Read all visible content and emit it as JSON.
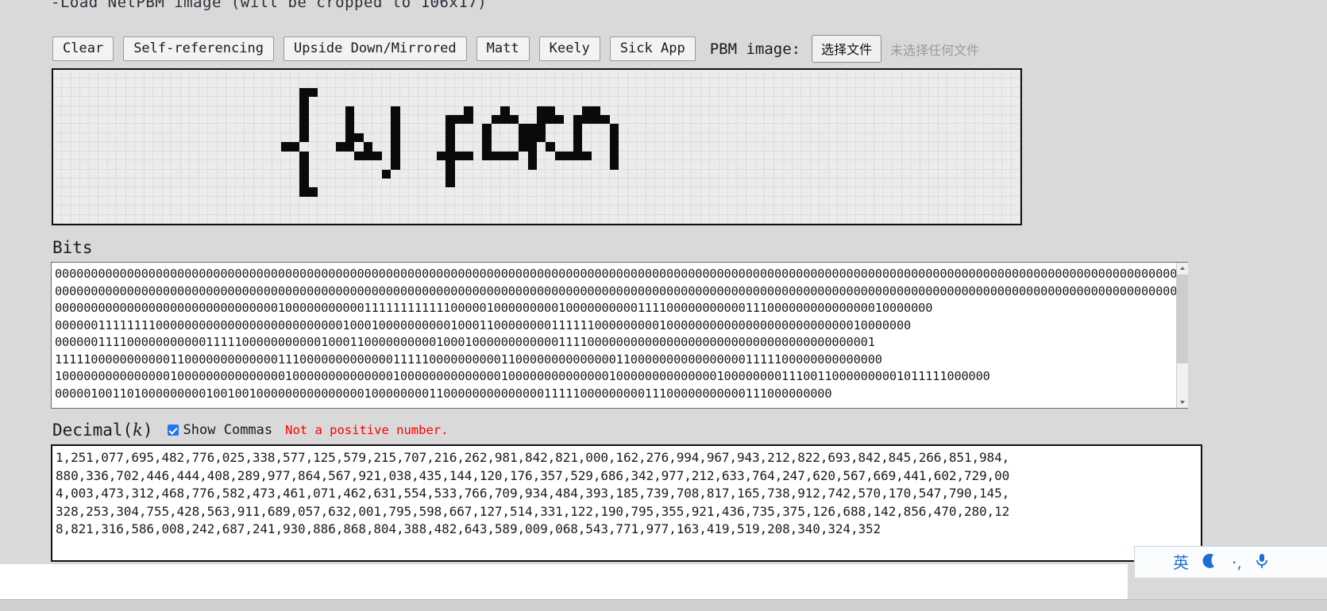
{
  "header": {
    "title": "-Load NetPBM image (will be cropped to 106x17)"
  },
  "toolbar": {
    "buttons": [
      {
        "name": "clear",
        "label": "Clear"
      },
      {
        "name": "self-referencing",
        "label": "Self-referencing"
      },
      {
        "name": "upside-down-mirrored",
        "label": "Upside Down/Mirrored"
      },
      {
        "name": "matt",
        "label": "Matt"
      },
      {
        "name": "keely",
        "label": "Keely"
      },
      {
        "name": "sick-app",
        "label": "Sick App"
      }
    ],
    "file_label": "PBM image:",
    "file_button": "选择文件",
    "file_status": "未选择任何文件"
  },
  "canvas": {
    "cols": 106,
    "rows": 17,
    "rows_bits": [
      "0000000000000000000000000000000000000000000000000000000000000000000000000000000000000000000000000000000000",
      "0000000000000000000000000000000000000000000000000000000000000000000000000000000000000000000000000000000000",
      "0000000000000000000000000001100000000000000000000000000000000000000000000000000000000000000000000000000000",
      "0000000000000000000000000001000000000000000000000000000000000000000000000000000000000000000000000000000000",
      "0000000000000000000000000001000010000100000001000100011000110000000000000000000000000000000000000000000000",
      "0000000000000000000000000001000010000100000111001110011101111000000000000000000000000000000000000000000000",
      "0000000000000000000000000001000010000100000100010001110001000100000000000000000000000000000000000000000000",
      "0000000000000000000000000001000011000100000100010001110001000100000000000000000000000000000000000000000000",
      "0000000000000000000000000110000110100100000100010001101001000100000000000000000000000000000000000000000000",
      "0000000000000000000000000001000001110100001111011110100111100100000000000000000000000000000000000000000000",
      "0000000000000000000000000001000000000100000100000000100000000100000000000000000000000000000000000000000000",
      "0000000000000000000000000001000000001000000100000000000000000000000000000000000000000000000000000000000000",
      "0000000000000000000000000001000000000000000100000000000000000000000000000000000000000000000000000000000000",
      "0000000000000000000000000001100000000000000000000000000000000000000000000000000000000000000000000000000000",
      "0000000000000000000000000000000000000000000000000000000000000000000000000000000000000000000000000000000000",
      "0000000000000000000000000000000000000000000000000000000000000000000000000000000000000000000000000000000000",
      "0000000000000000000000000000000000000000000000000000000000000000000000000000000000000000000000000000000000"
    ]
  },
  "bits": {
    "label": "Bits",
    "value": "00000000000000000000000000000000000000000000000000000000000000000000000000000000000000000000000000000000000000000000000000000000000000000000000000000000000000000000000000000000000000000000\n00000000000000000000000000000000000000000000000000000000000000000000000000000000000000000000000000000000000000000000000000000000000000000000000000000000000000000000000000000000000000000000\n00000000000000000000000000000001000000000001111111111110000010000000001000000000011110000000000011100000000000000010000000\n00000011111111000000000000000000000000001000100000000001000110000000011111100000000010000000000000000000000000010000000\n000000111100000000000111110000000000010001100000000001000100000000000011110000000000000000000000000000000000000001\n1111100000000000110000000000000111000000000000011111000000000011000000000000001100000000000000001111100000000000000\n1000000000000000100000000000000010000000000000010000000000000010000000000000010000000000000010000000011100110000000001011111000000\n000001001101000000000100100100000000000000010000000011000000000000001111100000000011100000000000111000000000"
  },
  "decimal": {
    "label_prefix": "Decimal(",
    "label_var": "k",
    "label_suffix": ")",
    "commas_label": "Show Commas",
    "commas_checked": true,
    "error": "Not a positive number.",
    "value": "1,251,077,695,482,776,025,338,577,125,579,215,707,216,262,981,842,821,000,162,276,994,967,943,212,822,693,842,845,266,851,984,\n880,336,702,446,444,408,289,977,864,567,921,038,435,144,120,176,357,529,686,342,977,212,633,764,247,620,567,669,441,602,729,00\n4,003,473,312,468,776,582,473,461,071,462,631,554,533,766,709,934,484,393,185,739,708,817,165,738,912,742,570,170,547,790,145,\n328,253,304,755,428,563,911,689,057,632,001,795,598,667,127,514,331,122,190,795,355,921,436,735,375,126,688,142,856,470,280,12\n8,821,316,586,008,242,687,241,930,886,868,804,388,482,643,589,009,068,543,771,977,163,419,519,208,340,324,352"
  },
  "ime": {
    "logo": "sogou-logo",
    "mode": "英",
    "moon": "☽",
    "punct": "·,",
    "mic": "🎤"
  },
  "colors": {
    "page_bg": "#d9d9d9",
    "accent": "#2176f3",
    "error": "#ff0000",
    "ime_blue": "#1a6fd4",
    "ime_orange": "#f5741f",
    "bitmap_on": "#0a0a0a",
    "bitmap_bg": "#ececec"
  }
}
